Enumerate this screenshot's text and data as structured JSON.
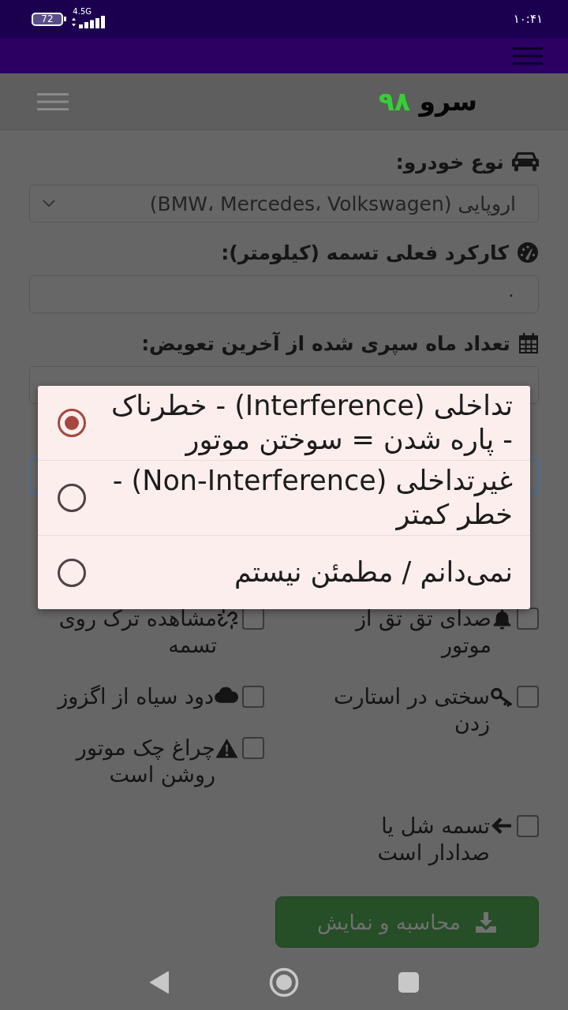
{
  "status_bar": {
    "battery": "72",
    "network": "4.5G",
    "time": "۱۰:۴۱"
  },
  "header": {
    "logo": {
      "name": "سرو",
      "number": "۹۸"
    }
  },
  "form": {
    "fields": [
      {
        "kind": "select",
        "label": "نوع خودرو:",
        "value": "اروپایی (BMW، Mercedes، Volkswagen)",
        "focused": false
      },
      {
        "kind": "input",
        "label": "کارکرد فعلی تسمه (کیلومتر):",
        "value": "۰",
        "focused": false
      },
      {
        "kind": "input",
        "label": "تعداد ماه سپری شده از آخرین تعویض:",
        "focused": false
      },
      {
        "kind": "select",
        "focused": true
      }
    ],
    "symptoms": [
      {
        "label": "صدای تق تق از موتور",
        "checked": false
      },
      {
        "label": "مشاهده ترک روی تسمه",
        "checked": false
      },
      {
        "label": "سختی در استارت زدن",
        "checked": false
      },
      {
        "label": "دود سیاه از اگزوز",
        "checked": false
      },
      {
        "label": "چراغ چک موتور روشن است",
        "checked": false
      },
      {
        "label": "تسمه شل یا صدادار است",
        "checked": false
      }
    ],
    "submit_button": {
      "label": "محاسبه و نمایش"
    }
  },
  "dropdown": {
    "options": [
      {
        "label": "تداخلی (Interference) - خطرناک - پاره شدن = سوختن موتور",
        "selected": true
      },
      {
        "label": "غیرتداخلی (Non-Interference) - خطر کمتر",
        "selected": false
      },
      {
        "label": "نمی‌دانم / مطمئن نیستم",
        "selected": false
      }
    ]
  }
}
